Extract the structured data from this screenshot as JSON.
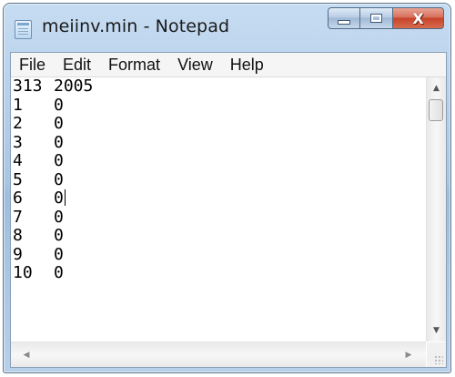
{
  "window": {
    "title": "meiinv.min - Notepad",
    "controls": {
      "minimize": "",
      "maximize": "",
      "close": "X"
    }
  },
  "menu": [
    {
      "label": "File"
    },
    {
      "label": "Edit"
    },
    {
      "label": "Format"
    },
    {
      "label": "View"
    },
    {
      "label": "Help"
    }
  ],
  "document": {
    "lines": [
      [
        "313",
        "2005"
      ],
      [
        "1",
        "0"
      ],
      [
        "2",
        "0"
      ],
      [
        "3",
        "0"
      ],
      [
        "4",
        "0"
      ],
      [
        "5",
        "0"
      ],
      [
        "6",
        "0"
      ],
      [
        "7",
        "0"
      ],
      [
        "8",
        "0"
      ],
      [
        "9",
        "0"
      ],
      [
        "10",
        "0"
      ]
    ]
  },
  "icons": {
    "app": "notepad-icon",
    "scroll_up": "arrow-up-icon",
    "scroll_down": "arrow-down-icon",
    "scroll_left": "arrow-left-icon",
    "scroll_right": "arrow-right-icon"
  },
  "colors": {
    "titlebar": "#a9c6e4",
    "close": "#c7432b"
  }
}
